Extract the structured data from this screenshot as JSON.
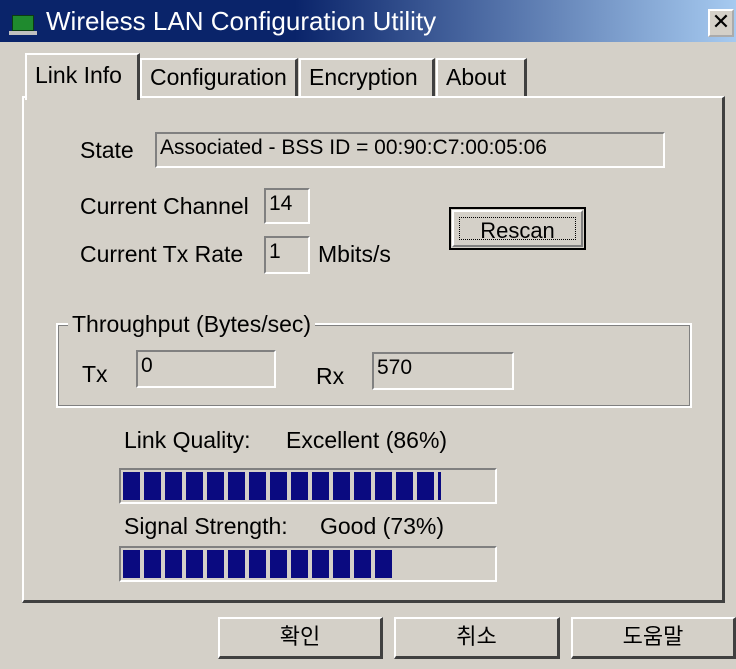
{
  "window": {
    "title": "Wireless LAN Configuration Utility",
    "close_glyph": "✕"
  },
  "tabs": [
    "Link Info",
    "Configuration",
    "Encryption",
    "About"
  ],
  "active_tab": 0,
  "link_info": {
    "state_label": "State",
    "state_value": "Associated - BSS ID = 00:90:C7:00:05:06",
    "channel_label": "Current Channel",
    "channel_value": "14",
    "tx_rate_label": "Current Tx Rate",
    "tx_rate_value": "1",
    "tx_rate_unit": "Mbits/s",
    "rescan_label": "Rescan"
  },
  "throughput": {
    "title": "Throughput (Bytes/sec)",
    "tx_label": "Tx",
    "tx_value": "0",
    "rx_label": "Rx",
    "rx_value": "570"
  },
  "link_quality": {
    "label": "Link Quality:",
    "value_text": "Excellent (86%)",
    "fill_fraction": 0.86
  },
  "signal_strength": {
    "label": "Signal Strength:",
    "value_text": "Good (73%)",
    "fill_fraction": 0.73
  },
  "bar_color": "#0a0a80",
  "buttons": {
    "ok": "확인",
    "cancel": "취소",
    "help": "도움말"
  }
}
